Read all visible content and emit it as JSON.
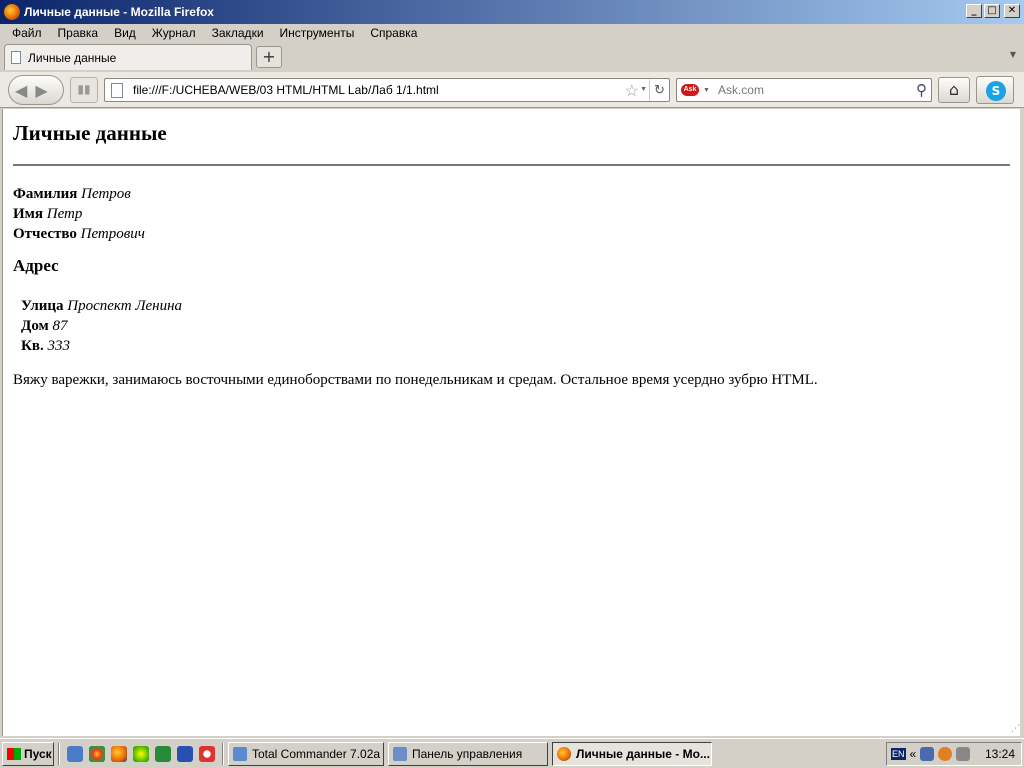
{
  "window": {
    "title": "Личные данные - Mozilla Firefox"
  },
  "menu": [
    "Файл",
    "Правка",
    "Вид",
    "Журнал",
    "Закладки",
    "Инструменты",
    "Справка"
  ],
  "tab": {
    "title": "Личные данные"
  },
  "urlbar": {
    "value": "file:///F:/UCHEBA/WEB/03 HTML/HTML Lab/Лаб 1/1.html"
  },
  "searchbar": {
    "placeholder": "Ask.com",
    "engine": "Ask"
  },
  "page": {
    "heading": "Личные данные",
    "fields": [
      {
        "label": "Фамилия",
        "value": "Петров"
      },
      {
        "label": "Имя",
        "value": "Петр"
      },
      {
        "label": "Отчество",
        "value": "Петрович"
      }
    ],
    "address_heading": "Адрес",
    "address": [
      {
        "label": "Улица",
        "value": "Проспект Ленина"
      },
      {
        "label": "Дом",
        "value": "87"
      },
      {
        "label": "Кв.",
        "value": "333"
      }
    ],
    "paragraph": "Вяжу варежки, занимаюсь восточными единоборствами по понедельникам и средам. Остальное время усердно зубрю HTML."
  },
  "taskbar": {
    "start_label": "Пуск",
    "tasks": [
      {
        "label": "Total Commander 7.02a ...",
        "active": false
      },
      {
        "label": "Панель управления",
        "active": false
      },
      {
        "label": "Личные данные - Mo...",
        "active": true
      }
    ],
    "lang": "EN",
    "clock": "13:24"
  }
}
